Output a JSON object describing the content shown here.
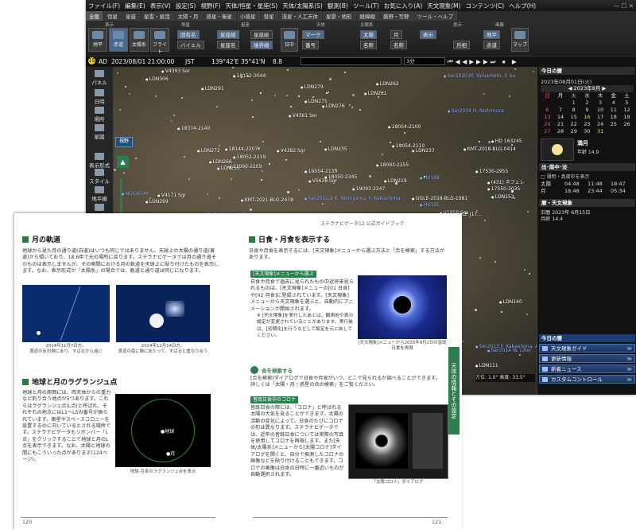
{
  "app": {
    "menu": [
      "ファイル(F)",
      "編集(E)",
      "表示(V)",
      "設定(S)",
      "視野(F)",
      "天体/恒星・星座(S)",
      "天体/太陽系(S)",
      "観測(B)",
      "ツール(T)",
      "お気に入り(A)",
      "天文現象(M)",
      "コンテンツ(C)",
      "ヘルプ(H)"
    ],
    "tabs": [
      "全般",
      "恒星",
      "星座",
      "星雲・星団",
      "太陽・月",
      "惑星・衛星",
      "小惑星",
      "彗星",
      "流星・人工天体",
      "星景・地形",
      "経緯線",
      "雑野・写野",
      "ツール・ヘルプ"
    ],
    "toolbar": {
      "groups": [
        "表示",
        "恒星",
        "星座",
        "太陽系",
        "天体",
        "表示",
        "画像"
      ],
      "big_buttons": [
        "地平",
        "赤道",
        "太陽系",
        "フライト"
      ],
      "small_buttons": [
        "固有名",
        "バイエル",
        "星座線",
        "星座名",
        "星座絵",
        "境界線",
        "日中",
        "マーク",
        "番号",
        "太陽",
        "月",
        "名称",
        "名称",
        "表示",
        "月相",
        "地平",
        "赤道",
        "マップ"
      ]
    },
    "status": {
      "ad": "AD",
      "datetime": "2023/08/01 21:00:00",
      "tz": "JST",
      "lon": "139°42'E",
      "lat": "35°41'N",
      "mag": "8.8",
      "speed": "3分"
    },
    "leftpanel": [
      "パネル",
      "日時",
      "場所",
      "星図",
      "表示形式",
      "スタイル",
      "地平線",
      "方位"
    ],
    "sky_labels": [
      {
        "t": "V4393 Ser",
        "c": "white"
      },
      {
        "t": "LDN306",
        "c": "white"
      },
      {
        "t": "18152-3044",
        "c": "white"
      },
      {
        "t": "LDN291",
        "c": "white"
      },
      {
        "t": "LDN279",
        "c": "white"
      },
      {
        "t": "LDN275",
        "c": "white"
      },
      {
        "t": "LDN276",
        "c": "white"
      },
      {
        "t": "LDN262",
        "c": "white"
      },
      {
        "t": "LDN261",
        "c": "white"
      },
      {
        "t": "V4361 Ser",
        "c": "white"
      },
      {
        "t": "18054-2100",
        "c": "white"
      },
      {
        "t": "V4382 Sgr",
        "c": "white"
      },
      {
        "t": "18374-2140",
        "c": "white"
      },
      {
        "t": "LDN272",
        "c": "white"
      },
      {
        "t": "LDN266",
        "c": "white"
      },
      {
        "t": "18144-2207",
        "c": "white"
      },
      {
        "t": "18052-2219",
        "c": "white"
      },
      {
        "t": "11060-2209",
        "c": "white"
      },
      {
        "t": "LDN255",
        "c": "white"
      },
      {
        "t": "LDN235",
        "c": "white"
      },
      {
        "t": "V5638 Sgr",
        "c": "white"
      },
      {
        "t": "V4171 Sgr",
        "c": "white"
      },
      {
        "t": "LDN269",
        "c": "white"
      },
      {
        "t": "NGC6594",
        "c": "blue"
      },
      {
        "t": "Ser2020 M. Yamamoto, Y. Sa",
        "c": "blue"
      },
      {
        "t": "Ser2014 H. Nishimura",
        "c": "blue"
      },
      {
        "t": "Ser2011/2 K. Nishiyama, F. Kabashima",
        "c": "blue"
      },
      {
        "t": "Ser1950 D. Hottiers",
        "c": "blue"
      },
      {
        "t": "17550-3035",
        "c": "white"
      },
      {
        "t": "17530-2955",
        "c": "white"
      },
      {
        "t": "LDN237",
        "c": "white"
      },
      {
        "t": "18054-2110",
        "c": "white"
      },
      {
        "t": "HD 163245",
        "c": "white"
      },
      {
        "t": "KMT-2018-BLG-0414",
        "c": "white"
      },
      {
        "t": "(431) ネフェレ",
        "c": "white"
      },
      {
        "t": "TCP J17...",
        "c": "white"
      },
      {
        "t": "LDN140",
        "c": "white"
      },
      {
        "t": "LDN165",
        "c": "white"
      },
      {
        "t": "LDN166",
        "c": "white"
      },
      {
        "t": "OGLE-2018-BLG-1981",
        "c": "white"
      },
      {
        "t": "V1958 Sgr",
        "c": "white"
      },
      {
        "t": "HV191",
        "c": "blue"
      },
      {
        "t": "HV168",
        "c": "blue"
      },
      {
        "t": "LDN221",
        "c": "white"
      },
      {
        "t": "LDN227",
        "c": "white"
      },
      {
        "t": "LDN2193",
        "c": "white"
      },
      {
        "t": "API Sgr 2007",
        "c": "white"
      },
      {
        "t": "KMT-2021-BLG-2478",
        "c": "white"
      },
      {
        "t": "Ser2014 W. Liller",
        "c": "blue"
      },
      {
        "t": "Ser2013 F. Kabashima, ASASSN-16ie",
        "c": "blue"
      },
      {
        "t": "LDN111",
        "c": "white"
      },
      {
        "t": "LDN152",
        "c": "white"
      },
      {
        "t": "18092-2130",
        "c": "white"
      },
      {
        "t": "18093-2255",
        "c": "white"
      },
      {
        "t": "19093-2247",
        "c": "white"
      },
      {
        "t": "18050-2345",
        "c": "white"
      },
      {
        "t": "16054-2130",
        "c": "white"
      },
      {
        "t": "LDN219",
        "c": "white"
      },
      {
        "t": "E. Woods",
        "c": "white"
      }
    ],
    "sky_footer": {
      "dir_label": "方位:",
      "dir_val": "1.0°",
      "alt_label": "高度:",
      "alt_val": "33.5°"
    },
    "right": {
      "title": "今日の暦",
      "date": "2023年08月01日(火)",
      "cal_title": "2023年8月",
      "weekdays": [
        "日",
        "月",
        "火",
        "水",
        "木",
        "金",
        "土"
      ],
      "weeks": [
        [
          "",
          "",
          "1",
          "2",
          "3",
          "4",
          "5"
        ],
        [
          "6",
          "7",
          "8",
          "9",
          "10",
          "11",
          "12"
        ],
        [
          "13",
          "14",
          "15",
          "16",
          "17",
          "18",
          "19"
        ],
        [
          "20",
          "21",
          "22",
          "23",
          "24",
          "25",
          "26"
        ],
        [
          "27",
          "28",
          "29",
          "30",
          "31",
          "",
          ""
        ]
      ],
      "koyomi": "満月",
      "moon_info": "年齢 14.9",
      "sun_label": "出･南中･没",
      "sun_note": "□ 薄明・真夜中を表示",
      "sun_rows": [
        {
          "name": "太陽",
          "rise": "04:48",
          "transit": "11:48",
          "set": "18:47"
        },
        {
          "name": "月",
          "rise": "18:48",
          "transit": "23:44",
          "set": "05:34"
        }
      ],
      "phenom_head": "暦・天文現象",
      "phenom": "旧暦 2023年 6月15日\n月齢 14.4",
      "sub_title": "今日の暦",
      "buttons": [
        "天文現象ガイド",
        "更新情報",
        "新着ニュース",
        "カスタムコントロール"
      ]
    }
  },
  "book": {
    "header": "ステラナビゲータ12 公式ガイドブック",
    "left": {
      "h1": "月の軌道",
      "p1": "地球から見た月の通り道(白道)はいつも同じではありません。天球上の太陽の通り道(黄道)から傾いており、18.6年で元の場所に戻ります。ステラナビゲータでは月の通り道そのものは表示しませんが、その瞬間における月の軌道を天球上に貼り付けたものを表示します。なお、表示形式が「太陽系」の場合では、軌道と通り道は同じになります。",
      "cap1": "2014年11月7日方。\n黄道の反対側にあり、すばるから遠い",
      "cap2": "2024年12月14日方。\n黄道の南に側にあたって、すばると重なり合う",
      "h2": "地球と月のラグランジュ点",
      "p2": "地球と月の周囲には、両天体からの重力など釣り合う地点が5つあります。これらはラグランジュ点(L点)と呼ばれ、それぞれの地点にはL1〜L5の番号が振られています。衛星やスペースコロニーを設置するのに向いているとされる場所です。ステラナビゲータもリボンバー「L点」をクリックすることで地球と月のL点を表示できます。なお、太陽と地球の間にもこういった点があります(124ページ)。",
      "earth": "●地球",
      "moon": "●月",
      "cap3": "地球-月系のラグランジュ点を表示",
      "pageno": "120"
    },
    "right": {
      "h1": "日食・月食を表示する",
      "p1": "日食や月食を表示するには、[天文現象]メニューから選ぶ方法と「合を検索」する方法があります。",
      "tag1": "[天文現象]メニューから選ぶ",
      "p2": "日食や月食で過去に見られたもの中近将来見られるものは、[天文現象]メニューの[01 日食]や[02 月食]に登録されています。[天文現象]メニューから天文現象を選ぶと、自動的にアニメーションが開始されます。",
      "note": "※ [天文現象]を実行したあとは、観測地や表示設定が変更されていることがあります。実行後は、[初期化]を行うなどして設定を元に戻してください。",
      "cap1": "[天文現象]メニューから2035年9月2日の皆既日食を再現",
      "h2": "合を検索する",
      "p3": "[合を検索]ダイアログで日食や月食がいつ、どこで見られるか調べることができます。詳しくは「太陽・月・惑星の合の検索」をご覧ください。",
      "tag2": "皆既日食中のコロナ",
      "p4": "皆既日食の際には、「コロナ」と呼ばれる太陽の大気を見ることができます。太陽の活動の変化によって、日食のたびにコロナの形は異なります。ステラナビゲータでは、近年の皆既日食については実際の写真を使用してコロナを再現します。また[天体/太陽系]メニューから[太陽コロナ]ダイアログを開くと、自分で推測したコロナの画像などを貼り付けることもできます。コロナの画像は日食の日時に一番近いものが自動選択されます。",
      "cap2": "「太陽コロナ」ダイアログ",
      "sidetab": "天体の情報とその設定",
      "pageno": "121"
    }
  }
}
